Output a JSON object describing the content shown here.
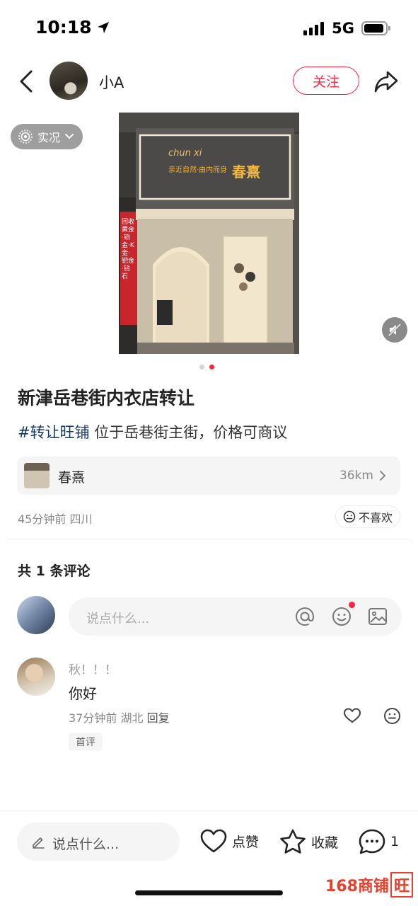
{
  "status_bar": {
    "time": "10:18",
    "network": "5G"
  },
  "header": {
    "author_name": "小A",
    "follow_label": "关注"
  },
  "media": {
    "live_label": "实况",
    "sign_script": "chun xi",
    "sign_slogan": "亲近自然·由内而身",
    "sign_brand": "春熹",
    "side_banner": "回收黄金·铂金·K金·钯金·钻石",
    "page_count": 2,
    "active_page": 2
  },
  "post": {
    "title": "新津岳巷街内衣店转让",
    "hashtag": "#转让旺铺",
    "description": " 位于岳巷街主街，价格可商议",
    "shop": {
      "name": "春熹",
      "distance": "36km"
    },
    "time": "45分钟前",
    "location": "四川",
    "dislike_label": "不喜欢"
  },
  "comments": {
    "count_label": "共 1 条评论",
    "input_placeholder": "说点什么...",
    "items": [
      {
        "user": "秋！！！",
        "text": "你好",
        "time": "37分钟前",
        "location": "湖北",
        "reply_label": "回复",
        "badge": "首评"
      }
    ]
  },
  "bottom_bar": {
    "input_placeholder": "说点什么...",
    "like_label": "点赞",
    "collect_label": "收藏",
    "comment_count": "1"
  },
  "watermark": {
    "text": "168商铺",
    "boxed": "旺"
  },
  "colors": {
    "accent": "#ff2442",
    "hashtag": "#13386c",
    "watermark": "#e8402d"
  }
}
